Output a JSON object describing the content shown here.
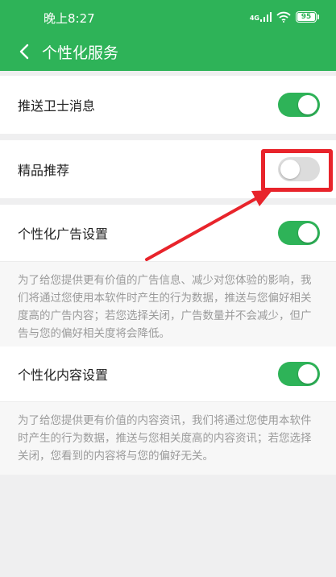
{
  "status_bar": {
    "time": "晚上8:27",
    "network": "4G",
    "battery": "95"
  },
  "nav": {
    "title": "个性化服务"
  },
  "settings": {
    "push_guard": {
      "label": "推送卫士消息",
      "enabled": true
    },
    "featured": {
      "label": "精品推荐",
      "enabled": false
    },
    "ad_personalization": {
      "label": "个性化广告设置",
      "enabled": true,
      "description": "为了给您提供更有价值的广告信息、减少对您体验的影响，我们将通过您使用本软件时产生的行为数据，推送与您偏好相关度高的广告内容；若您选择关闭，广告数量并不会减少，但广告与您的偏好相关度将会降低。"
    },
    "content_personalization": {
      "label": "个性化内容设置",
      "enabled": true,
      "description": "为了给您提供更有价值的内容资讯，我们将通过您使用本软件时产生的行为数据，推送与您相关度高的内容资讯；若您选择关闭，您看到的内容将与您的偏好无关。"
    }
  },
  "colors": {
    "brand_green": "#2eb358",
    "annotation_red": "#e8242b",
    "toggle_off": "#dcdcdc"
  }
}
